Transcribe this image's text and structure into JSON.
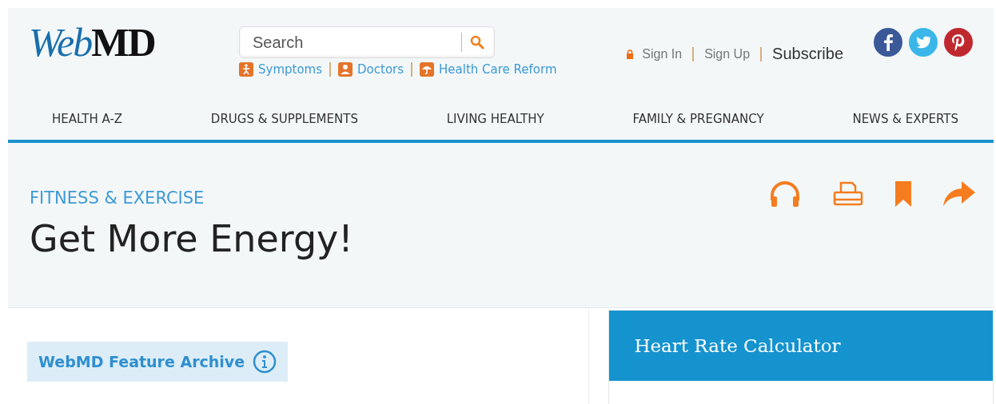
{
  "header": {
    "logo": [
      "Web",
      "MD"
    ],
    "search": {
      "placeholder": "Search"
    },
    "quick_links": [
      {
        "label": "Symptoms",
        "kind": "person"
      },
      {
        "label": "Doctors",
        "kind": "doctor"
      },
      {
        "label": "Health Care Reform",
        "kind": "umbrella"
      }
    ],
    "account_links": [
      "Sign In",
      "Sign Up"
    ],
    "subscribe": "Subscribe",
    "social": [
      {
        "kind": "facebook",
        "color": "#3b5998"
      },
      {
        "kind": "twitter",
        "color": "#3ab7e8"
      },
      {
        "kind": "pinterest",
        "color": "#c0282f"
      }
    ]
  },
  "nav": [
    "HEALTH A-Z",
    "DRUGS & SUPPLEMENTS",
    "LIVING HEALTHY",
    "FAMILY & PREGNANCY",
    "NEWS & EXPERTS"
  ],
  "article": {
    "category": "FITNESS & EXERCISE",
    "title": "Get More Energy!",
    "tools": [
      {
        "kind": "listen"
      },
      {
        "kind": "print"
      },
      {
        "kind": "bookmark"
      },
      {
        "kind": "share"
      }
    ]
  },
  "archive_label": "WebMD Feature Archive",
  "sidebar": {
    "card_title": "Heart Rate Calculator"
  }
}
